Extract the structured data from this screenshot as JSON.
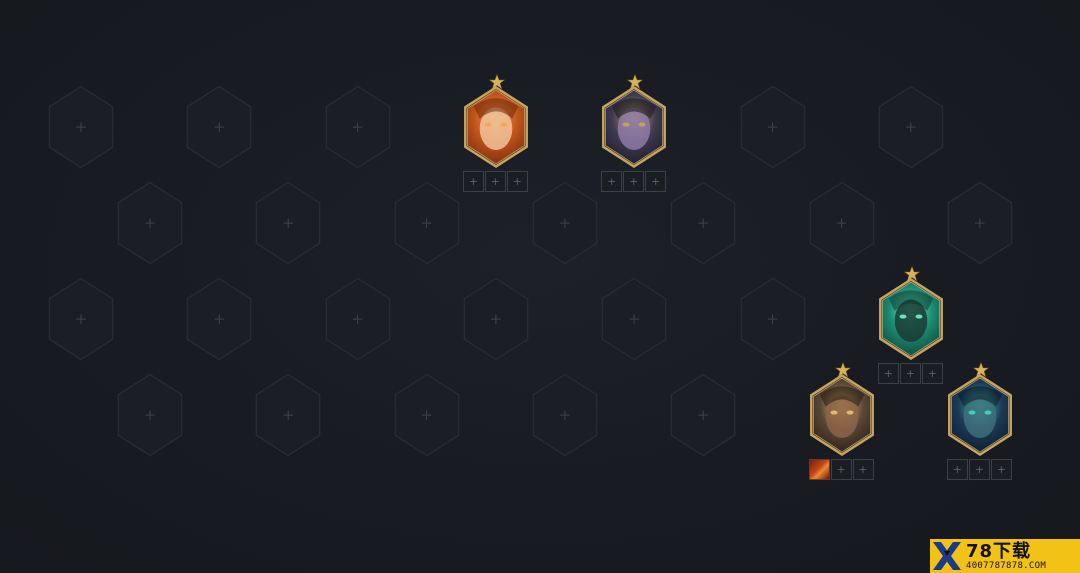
{
  "board": {
    "empty_slot_glyph": "+",
    "item_slot_glyph": "+",
    "colors": {
      "background": "#181b21",
      "hex_outline": "#272b32",
      "hex_fill": "#1b1e24",
      "plus": "#3a3e45",
      "gold_border": "#c9a45c",
      "star": "#d9b35a"
    }
  },
  "champions": [
    {
      "name_icon": "fiery-woman-portrait",
      "stars": 1,
      "items": [
        {
          "filled": false,
          "glyph": "+"
        },
        {
          "filled": false,
          "glyph": "+"
        },
        {
          "filled": false,
          "glyph": "+"
        }
      ],
      "colors": {
        "base": "#c2541c",
        "light": "#f3a352",
        "dark": "#6d2408",
        "face": "#f0c29a"
      }
    },
    {
      "name_icon": "armored-knight-portrait",
      "stars": 1,
      "items": [
        {
          "filled": false,
          "glyph": "+"
        },
        {
          "filled": false,
          "glyph": "+"
        },
        {
          "filled": false,
          "glyph": "+"
        }
      ],
      "colors": {
        "base": "#3d3a52",
        "light": "#c9a659",
        "dark": "#18161f",
        "face": "#8e7aa8"
      }
    },
    {
      "name_icon": "shadow-isles-spirit-portrait",
      "stars": 1,
      "items": [
        {
          "filled": false,
          "glyph": "+"
        },
        {
          "filled": false,
          "glyph": "+"
        },
        {
          "filled": false,
          "glyph": "+"
        }
      ],
      "colors": {
        "base": "#1d8a72",
        "light": "#6ff2cf",
        "dark": "#0a3a30",
        "face": "#1a3a33"
      }
    },
    {
      "name_icon": "glowing-eyed-warrior-portrait",
      "stars": 1,
      "items": [
        {
          "filled": true,
          "glyph": "",
          "icon": "fire-whip-item-icon"
        },
        {
          "filled": false,
          "glyph": "+"
        },
        {
          "filled": false,
          "glyph": "+"
        }
      ],
      "colors": {
        "base": "#5a4636",
        "light": "#e8c46a",
        "dark": "#211912",
        "face": "#8c6448"
      }
    },
    {
      "name_icon": "green-eyed-sorceress-portrait",
      "stars": 1,
      "items": [
        {
          "filled": false,
          "glyph": "+"
        },
        {
          "filled": false,
          "glyph": "+"
        },
        {
          "filled": false,
          "glyph": "+"
        }
      ],
      "colors": {
        "base": "#1c3a58",
        "light": "#3fd9b8",
        "dark": "#0b1624",
        "face": "#3e6e7a"
      }
    }
  ],
  "watermark": {
    "brand": "78下载",
    "url": "4007787878.COM",
    "colors": {
      "bg": "#f2c316",
      "x_main": "#1b3a8a",
      "x_accent": "#101010"
    }
  }
}
